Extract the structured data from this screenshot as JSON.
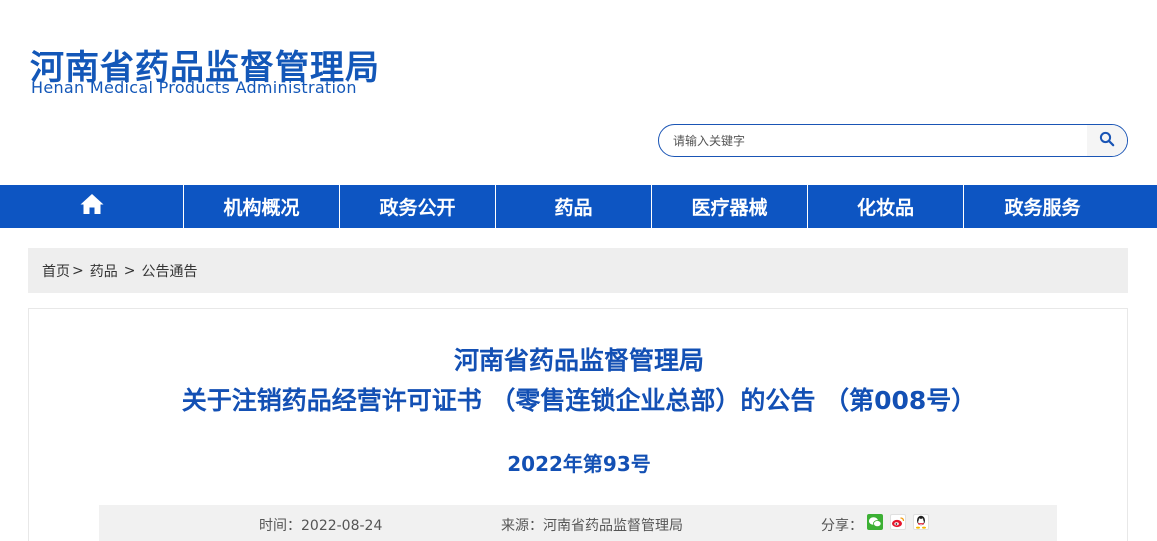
{
  "header": {
    "logo_cn": "河南省药品监督管理局",
    "logo_en": "Henan Medical Products Administration"
  },
  "search": {
    "placeholder": "请输入关键字",
    "button_icon": "search-icon"
  },
  "nav": {
    "home_icon": "home-icon",
    "items": [
      {
        "label": "机构概况"
      },
      {
        "label": "政务公开"
      },
      {
        "label": "药品"
      },
      {
        "label": "医疗器械"
      },
      {
        "label": "化妆品"
      },
      {
        "label": "政务服务"
      }
    ]
  },
  "breadcrumb": {
    "items": [
      "首页",
      "药品",
      "公告通告"
    ],
    "separator": ">"
  },
  "article": {
    "title_line1": "河南省药品监督管理局",
    "title_line2": "关于注销药品经营许可证书 （零售连锁企业总部）的公告 （第008号）",
    "doc_number": "2022年第93号",
    "time_label": "时间：2022-08-24",
    "source_label": "来源：河南省药品监督管理局",
    "share_label": "分享：",
    "share_icons": [
      "wechat-icon",
      "weibo-icon",
      "qq-icon"
    ]
  },
  "colors": {
    "brand_blue": "#1357b8",
    "nav_blue": "#0d55c2",
    "breadcrumb_bg": "#eeeeee",
    "meta_bg": "#f1f1f1"
  }
}
